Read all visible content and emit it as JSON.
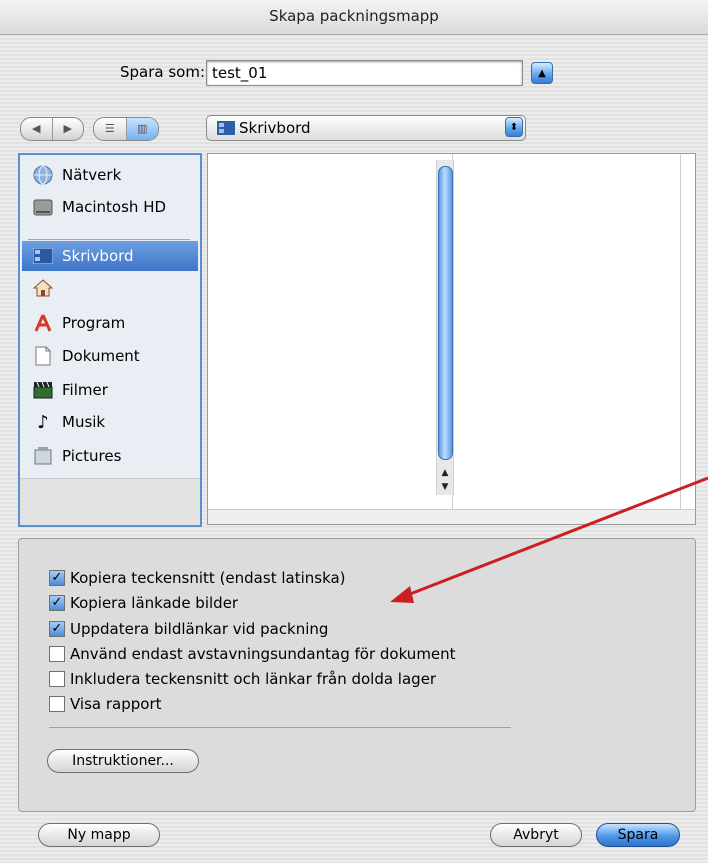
{
  "dialog": {
    "title": "Skapa packningsmapp"
  },
  "save_as": {
    "label": "Spara som:",
    "value": "test_01"
  },
  "location_popup": {
    "value": "Skrivbord"
  },
  "sidebar": {
    "items": [
      {
        "label": "Nätverk",
        "icon": "network-globe-icon"
      },
      {
        "label": "Macintosh HD",
        "icon": "hard-drive-icon"
      },
      {
        "label": "Skrivbord",
        "icon": "desktop-icon",
        "selected": true
      },
      {
        "label": "",
        "icon": "home-icon"
      },
      {
        "label": "Program",
        "icon": "applications-icon"
      },
      {
        "label": "Dokument",
        "icon": "documents-icon"
      },
      {
        "label": "Filmer",
        "icon": "movies-clapper-icon"
      },
      {
        "label": "Musik",
        "icon": "music-note-icon"
      },
      {
        "label": "Pictures",
        "icon": "pictures-icon"
      }
    ]
  },
  "options": {
    "checkboxes": [
      {
        "label": "Kopiera teckensnitt (endast latinska)",
        "checked": true
      },
      {
        "label": "Kopiera länkade bilder",
        "checked": true
      },
      {
        "label": "Uppdatera bildlänkar vid packning",
        "checked": true
      },
      {
        "label": "Använd endast avstavningsundantag för dokument",
        "checked": false
      },
      {
        "label": "Inkludera teckensnitt och länkar från dolda lager",
        "checked": false
      },
      {
        "label": "Visa rapport",
        "checked": false
      }
    ],
    "instructions_label": "Instruktioner..."
  },
  "buttons": {
    "new_folder": "Ny mapp",
    "cancel": "Avbryt",
    "save": "Spara"
  },
  "colors": {
    "accent": "#3e75c8",
    "annotation_arrow": "#cc1f1f"
  }
}
